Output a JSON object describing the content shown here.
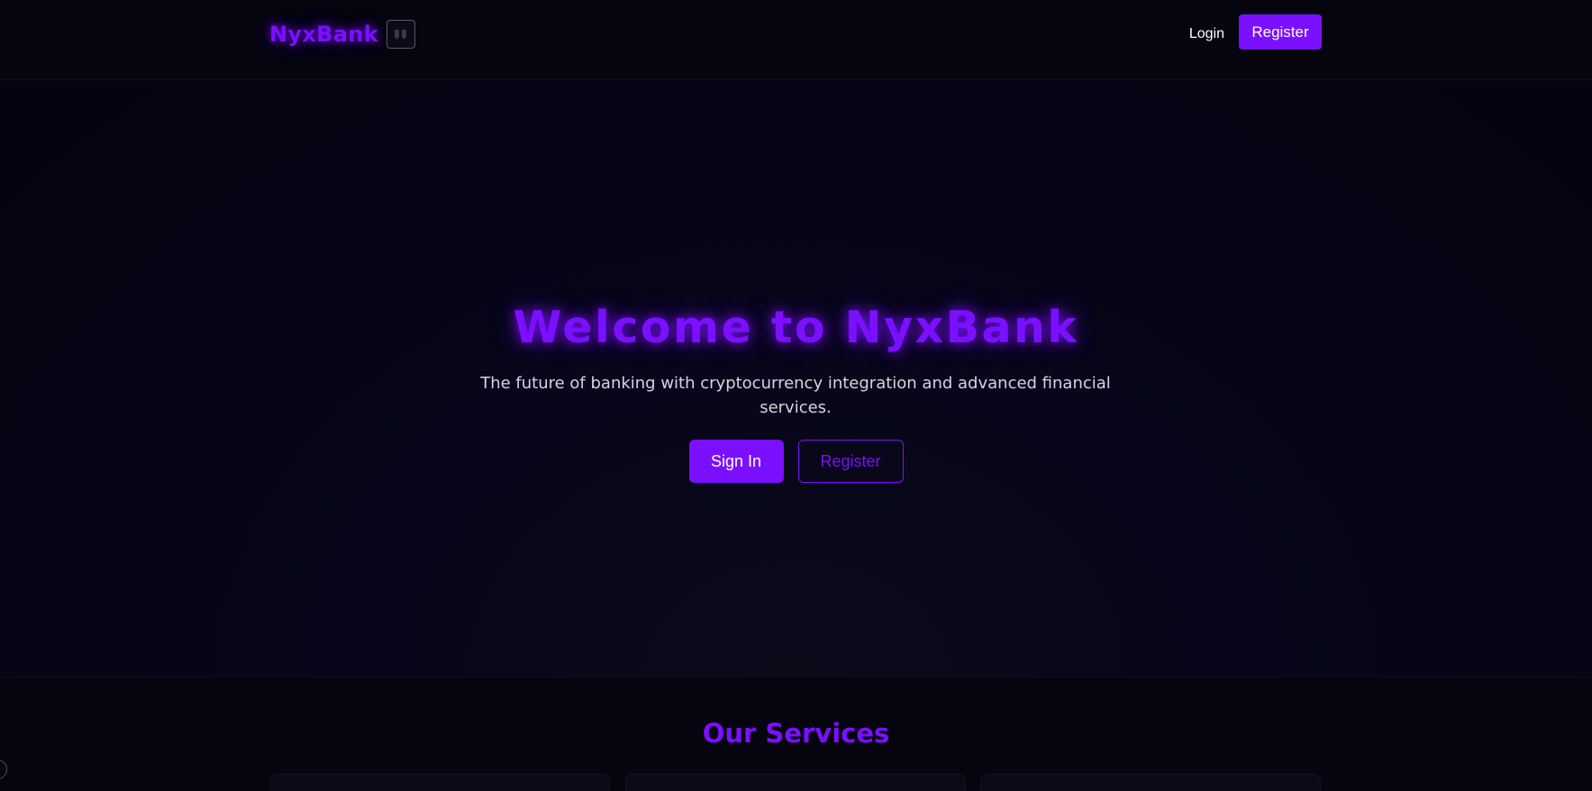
{
  "header": {
    "brand_name": "NyxBank",
    "brand_icon": "shield-badge-icon",
    "nav": {
      "login_label": "Login",
      "register_label": "Register"
    }
  },
  "hero": {
    "title": "Welcome to NyxBank",
    "subtitle": "The future of banking with cryptocurrency integration and advanced financial services.",
    "sign_in_label": "Sign In",
    "register_label": "Register"
  },
  "services": {
    "title": "Our Services"
  },
  "colors": {
    "accent": "#7b0fff",
    "background": "#05040f",
    "text": "#d6d3e2"
  }
}
